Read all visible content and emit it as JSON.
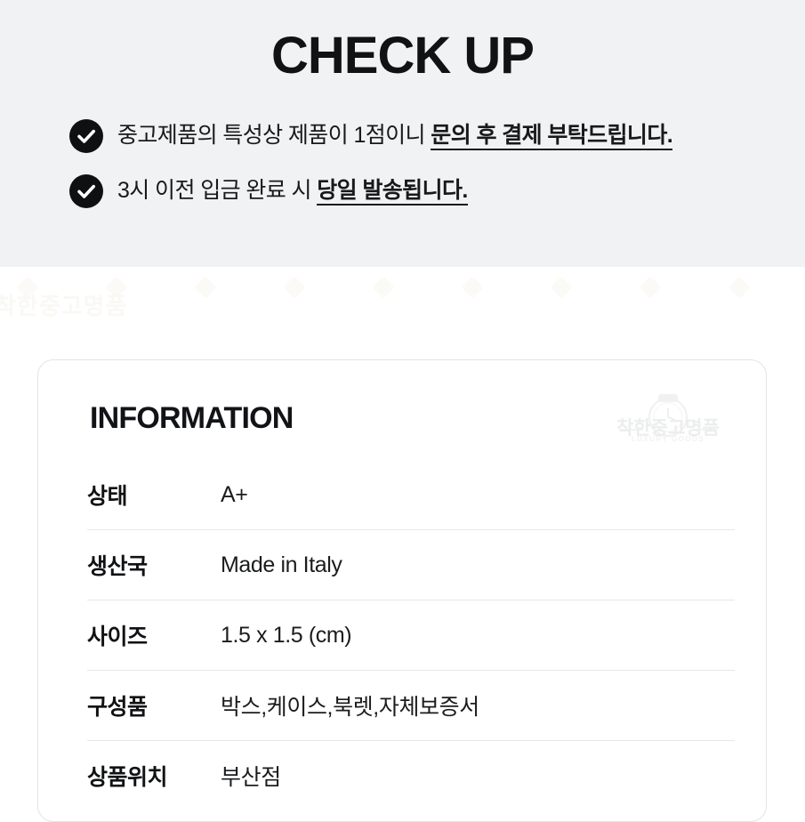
{
  "checkup": {
    "title": "CHECK UP",
    "bullets": [
      {
        "icon": "check-circle-icon",
        "text_plain": "중고제품의 특성상 제품이 1점이니 ",
        "text_emphasis": "문의 후 결제 부탁드립니다."
      },
      {
        "icon": "check-circle-icon",
        "text_plain": "3시 이전 입금 완료 시 ",
        "text_emphasis": "당일 발송됩니다."
      }
    ]
  },
  "information": {
    "title": "INFORMATION",
    "watermark": {
      "icon": "watch-logo-icon",
      "brand": "착한중고명품",
      "tagline": "LUXURY GOODS"
    },
    "rows": [
      {
        "label": "상태",
        "value": "A+"
      },
      {
        "label": "생산국",
        "value": "Made in Italy"
      },
      {
        "label": "사이즈",
        "value": "1.5 x 1.5 (cm)"
      },
      {
        "label": "구성품",
        "value": "박스,케이스,북렛,자체보증서"
      },
      {
        "label": "상품위치",
        "value": "부산점"
      }
    ]
  },
  "colors": {
    "band_background": "#f1f2f4",
    "page_background": "#ffffff",
    "text_primary": "#111214",
    "icon_fill": "#0f1012",
    "divider": "#e6e7e8",
    "card_border": "#e3e4e6"
  }
}
